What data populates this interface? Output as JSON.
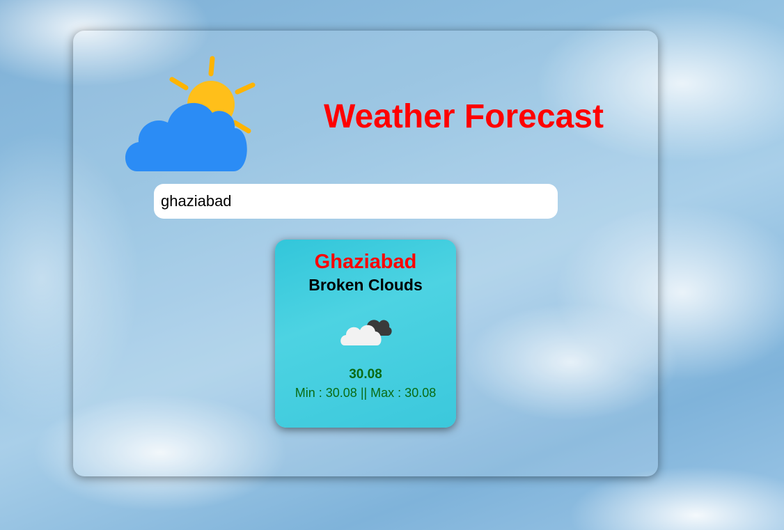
{
  "header": {
    "title": "Weather Forecast",
    "logo_icon": "sun-behind-cloud-icon"
  },
  "search": {
    "value": "ghaziabad"
  },
  "weather_card": {
    "city": "Ghaziabad",
    "description": "Broken Clouds",
    "icon": "broken-clouds-icon",
    "temperature": "30.08",
    "min_max": "Min : 30.08 || Max : 30.08"
  },
  "colors": {
    "title": "#ff0000",
    "card_background": "#3bc8dc",
    "temperature_text": "#0a6b14"
  }
}
